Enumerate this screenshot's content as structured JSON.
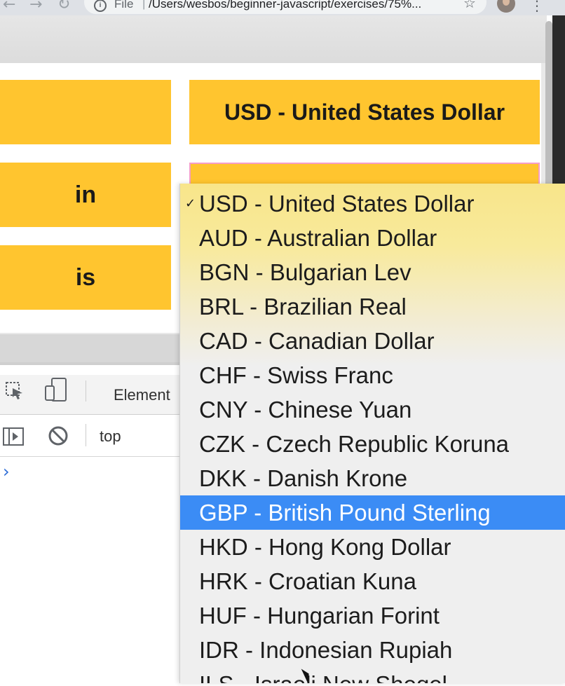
{
  "browser": {
    "back_icon": "←",
    "forward_icon": "→",
    "reload_icon": "↻",
    "info_icon": "i",
    "url_scheme": "File",
    "url_sep": "|",
    "url": "/Users/wesbos/beginner-javascript/exercises/75%...",
    "star_icon": "☆",
    "menu_icon": "⋮"
  },
  "form": {
    "in_label": "in",
    "is_label": "is",
    "from_currency": "USD - United States Dollar"
  },
  "devtools": {
    "tab_elements": "Element",
    "context": "top",
    "prompt": "›"
  },
  "dropdown": {
    "check": "✓",
    "options": [
      "USD - United States Dollar",
      "AUD - Australian Dollar",
      "BGN - Bulgarian Lev",
      "BRL - Brazilian Real",
      "CAD - Canadian Dollar",
      "CHF - Swiss Franc",
      "CNY - Chinese Yuan",
      "CZK - Czech Republic Koruna",
      "DKK - Danish Krone",
      "GBP - British Pound Sterling",
      "HKD - Hong Kong Dollar",
      "HRK - Croatian Kuna",
      "HUF - Hungarian Forint",
      "IDR - Indonesian Rupiah",
      "ILS - Israeli New Sheqel"
    ],
    "checked_option": "USD - United States Dollar",
    "highlighted_option": "GBP - British Pound Sterling"
  },
  "colors": {
    "accent_yellow": "#ffc52f",
    "highlight_blue": "#3b8cf5",
    "focus_border": "#f59ec8"
  }
}
